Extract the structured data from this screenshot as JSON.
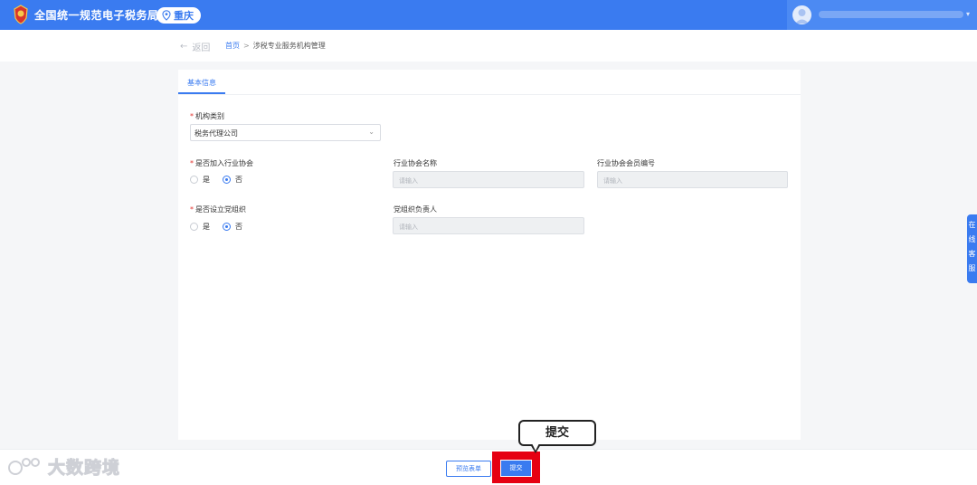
{
  "header": {
    "title": "全国统一规范电子税务局",
    "city": "重庆"
  },
  "breadcrumb": {
    "back": "返回",
    "home": "首页",
    "separator": ">",
    "current": "涉税专业服务机构管理"
  },
  "tabs": [
    {
      "label": "基本信息",
      "active": true
    }
  ],
  "form": {
    "org_type": {
      "label": "机构类别",
      "required": "*",
      "value": "税务代理公司"
    },
    "join_association": {
      "label": "是否加入行业协会",
      "required": "*",
      "options": [
        "是",
        "否"
      ],
      "selected": "否"
    },
    "association_name": {
      "label": "行业协会名称",
      "placeholder": "请输入"
    },
    "association_member_no": {
      "label": "行业协会会员编号",
      "placeholder": "请输入"
    },
    "party_org": {
      "label": "是否设立党组织",
      "required": "*",
      "options": [
        "是",
        "否"
      ],
      "selected": "否"
    },
    "party_leader": {
      "label": "党组织负责人",
      "placeholder": "请输入"
    }
  },
  "side_float": {
    "text": "在线客服"
  },
  "footer": {
    "preview_label": "预览表单",
    "submit_label": "提交"
  },
  "callout": {
    "text": "提交"
  },
  "watermark": {
    "text": "大数跨境"
  },
  "colors": {
    "primary": "#3a7bf0",
    "highlight": "#e60012",
    "required": "#e2342f"
  }
}
